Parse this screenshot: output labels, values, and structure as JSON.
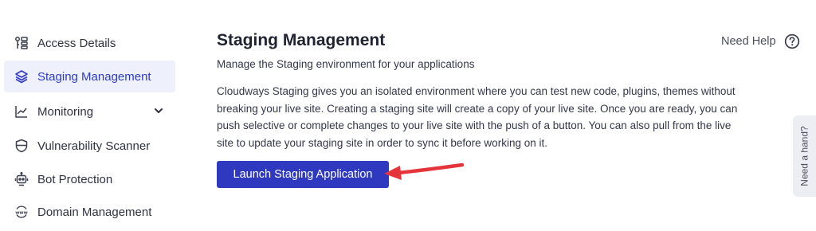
{
  "sidebar": {
    "items": [
      {
        "label": "Access Details",
        "icon": "access-details-icon"
      },
      {
        "label": "Staging Management",
        "icon": "layers-icon",
        "active": true
      },
      {
        "label": "Monitoring",
        "icon": "chart-line-icon",
        "expandable": true
      },
      {
        "label": "Vulnerability Scanner",
        "icon": "shield-scan-icon"
      },
      {
        "label": "Bot Protection",
        "icon": "robot-icon"
      },
      {
        "label": "Domain Management",
        "icon": "www-globe-icon"
      }
    ]
  },
  "main": {
    "title": "Staging Management",
    "subtitle": "Manage the Staging environment for your applications",
    "description": "Cloudways Staging gives you an isolated environment where you can test new code, plugins, themes without breaking your live site. Creating a staging site will create a copy of your live site. Once you are ready, you can push selective or complete changes to your live site with the push of a button. You can also pull from the live site to update your staging site in order to sync it before working on it.",
    "launch_button": "Launch Staging Application"
  },
  "header": {
    "help_label": "Need Help"
  },
  "side_tab": {
    "label": "Need a hand?"
  },
  "colors": {
    "accent": "#2f39bf",
    "active_bg": "#eef0fb",
    "arrow": "#e5353a"
  }
}
